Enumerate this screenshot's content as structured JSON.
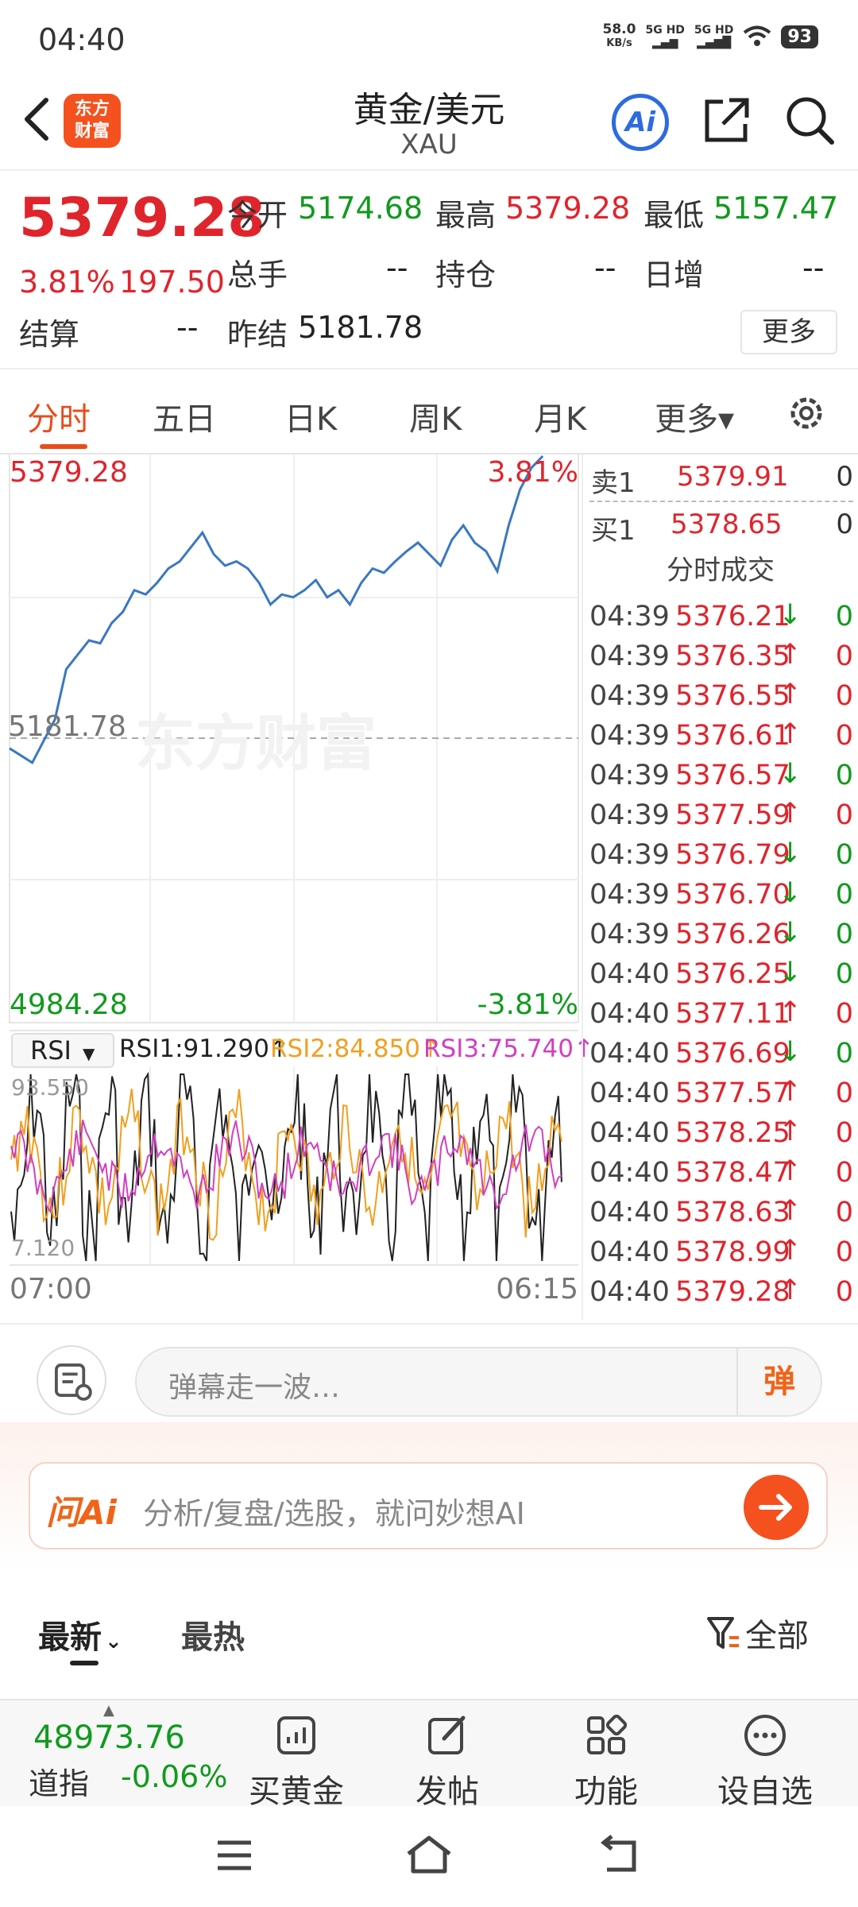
{
  "status": {
    "time": "04:40",
    "net_speed_value": "58.0",
    "net_speed_unit": "KB/s",
    "sim1": "5G HD",
    "sim2": "5G HD",
    "battery": "93"
  },
  "header": {
    "title": "黄金/美元",
    "subtitle": "XAU",
    "logo_text": "东方财富",
    "ai_label": "Ai"
  },
  "quote": {
    "price": "5379.28",
    "change_pct": "3.81%",
    "change_abs": "197.50",
    "open_label": "今开",
    "open": "5174.68",
    "high_label": "最高",
    "high": "5379.28",
    "low_label": "最低",
    "low": "5157.47",
    "volume_label": "总手",
    "volume": "--",
    "oi_label": "持仓",
    "oi": "--",
    "daily_inc_label": "日增",
    "daily_inc": "--",
    "settle_label": "结算",
    "settle": "--",
    "prev_settle_label": "昨结",
    "prev_settle": "5181.78",
    "more_label": "更多"
  },
  "tabs": [
    {
      "label": "分时",
      "active": true
    },
    {
      "label": "五日"
    },
    {
      "label": "日K"
    },
    {
      "label": "周K"
    },
    {
      "label": "月K"
    },
    {
      "label": "更多▾"
    }
  ],
  "chart": {
    "top_price": "5379.28",
    "top_pct": "3.81%",
    "mid_price": "5181.78",
    "bottom_price": "4984.28",
    "bottom_pct": "-3.81%",
    "watermark": "东方财富",
    "indicator": "RSI",
    "rsi1": "RSI1:91.290↑",
    "rsi2": "RSI2:84.850↑",
    "rsi3": "RSI3:75.740↑",
    "rsi_max": "93.550",
    "rsi_min": "7.120",
    "time_start": "07:00",
    "time_end": "06:15",
    "colors": {
      "price_line": "#3a78c0",
      "rsi1": "#222222",
      "rsi2": "#f0a020",
      "rsi3": "#d040c0"
    }
  },
  "chart_data": {
    "type": "line",
    "title": "",
    "xlabel": "",
    "ylabel": "",
    "ylim": [
      4984.28,
      5379.28
    ],
    "reference": 5181.78,
    "x_range": [
      "07:00",
      "06:15"
    ],
    "series": [
      {
        "name": "",
        "values": [
          5175,
          5170,
          5165,
          5180,
          5195,
          5230,
          5240,
          5250,
          5248,
          5262,
          5270,
          5285,
          5282,
          5290,
          5300,
          5305,
          5315,
          5325,
          5310,
          5302,
          5305,
          5300,
          5290,
          5275,
          5282,
          5280,
          5285,
          5292,
          5280,
          5285,
          5275,
          5290,
          5300,
          5297,
          5305,
          5312,
          5318,
          5310,
          5302,
          5320,
          5330,
          5318,
          5312,
          5298,
          5330,
          5355,
          5370,
          5379
        ]
      }
    ]
  },
  "orderbook": [
    {
      "label": "卖1",
      "price": "5379.91",
      "qty": "0"
    },
    {
      "label": "买1",
      "price": "5378.65",
      "qty": "0"
    }
  ],
  "trades_title": "分时成交",
  "trades": [
    {
      "time": "04:39",
      "price": "5376.21",
      "dir": "↓",
      "qty": "0"
    },
    {
      "time": "04:39",
      "price": "5376.35",
      "dir": "↑",
      "qty": "0"
    },
    {
      "time": "04:39",
      "price": "5376.55",
      "dir": "↑",
      "qty": "0"
    },
    {
      "time": "04:39",
      "price": "5376.61",
      "dir": "↑",
      "qty": "0"
    },
    {
      "time": "04:39",
      "price": "5376.57",
      "dir": "↓",
      "qty": "0"
    },
    {
      "time": "04:39",
      "price": "5377.59",
      "dir": "↑",
      "qty": "0"
    },
    {
      "time": "04:39",
      "price": "5376.79",
      "dir": "↓",
      "qty": "0"
    },
    {
      "time": "04:39",
      "price": "5376.70",
      "dir": "↓",
      "qty": "0"
    },
    {
      "time": "04:39",
      "price": "5376.26",
      "dir": "↓",
      "qty": "0"
    },
    {
      "time": "04:40",
      "price": "5376.25",
      "dir": "↓",
      "qty": "0"
    },
    {
      "time": "04:40",
      "price": "5377.11",
      "dir": "↑",
      "qty": "0"
    },
    {
      "time": "04:40",
      "price": "5376.69",
      "dir": "↓",
      "qty": "0"
    },
    {
      "time": "04:40",
      "price": "5377.57",
      "dir": "↑",
      "qty": "0"
    },
    {
      "time": "04:40",
      "price": "5378.25",
      "dir": "↑",
      "qty": "0"
    },
    {
      "time": "04:40",
      "price": "5378.47",
      "dir": "↑",
      "qty": "0"
    },
    {
      "time": "04:40",
      "price": "5378.63",
      "dir": "↑",
      "qty": "0"
    },
    {
      "time": "04:40",
      "price": "5378.99",
      "dir": "↑",
      "qty": "0"
    },
    {
      "time": "04:40",
      "price": "5379.28",
      "dir": "↑",
      "qty": "0"
    }
  ],
  "danmu": {
    "placeholder": "弹幕走一波…",
    "send_label": "弹"
  },
  "ai_bar": {
    "logo": "问Ai",
    "placeholder": "分析/复盘/选股，就问妙想AI"
  },
  "news_tabs": {
    "latest": "最新",
    "hot": "最热",
    "filter": "全部"
  },
  "bottom_bar": {
    "index_value": "48973.76",
    "index_label": "道指",
    "index_change": "-0.06%",
    "items": [
      {
        "label": "买黄金",
        "icon": "chart-icon"
      },
      {
        "label": "发帖",
        "icon": "edit-icon"
      },
      {
        "label": "功能",
        "icon": "grid-icon"
      },
      {
        "label": "设自选",
        "icon": "more-icon"
      }
    ]
  }
}
